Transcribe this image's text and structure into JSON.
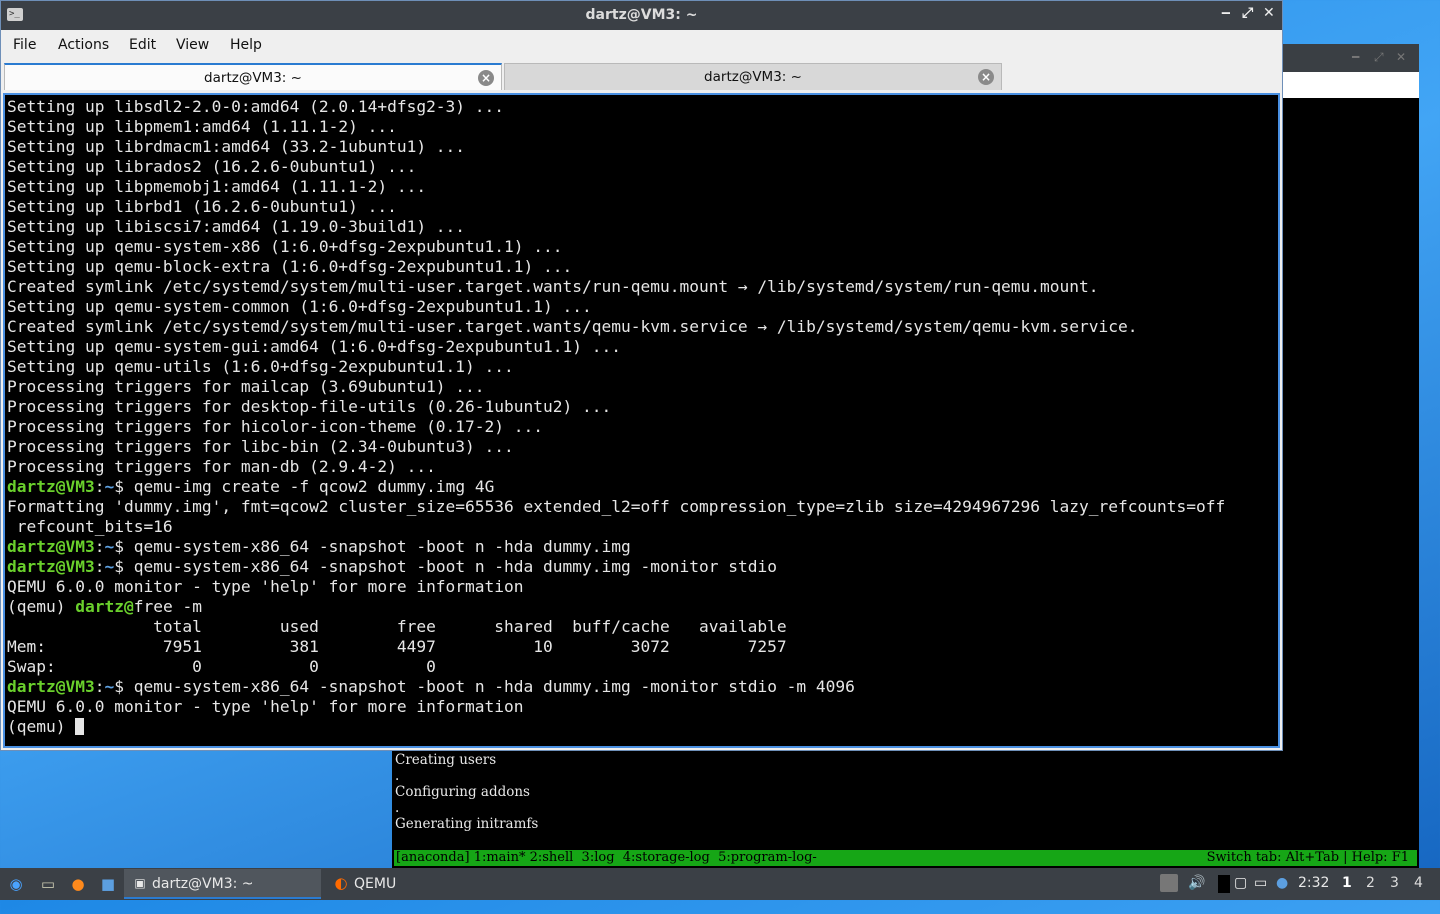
{
  "terminal_window": {
    "title": "dartz@VM3: ~",
    "menu": [
      "File",
      "Actions",
      "Edit",
      "View",
      "Help"
    ],
    "tabs": [
      {
        "label": "dartz@VM3: ~",
        "active": true
      },
      {
        "label": "dartz@VM3: ~",
        "active": false
      }
    ],
    "output_lines": [
      "Setting up libsdl2-2.0-0:amd64 (2.0.14+dfsg2-3) ...",
      "Setting up libpmem1:amd64 (1.11.1-2) ...",
      "Setting up librdmacm1:amd64 (33.2-1ubuntu1) ...",
      "Setting up librados2 (16.2.6-0ubuntu1) ...",
      "Setting up libpmemobj1:amd64 (1.11.1-2) ...",
      "Setting up librbd1 (16.2.6-0ubuntu1) ...",
      "Setting up libiscsi7:amd64 (1.19.0-3build1) ...",
      "Setting up qemu-system-x86 (1:6.0+dfsg-2expubuntu1.1) ...",
      "Setting up qemu-block-extra (1:6.0+dfsg-2expubuntu1.1) ...",
      "Created symlink /etc/systemd/system/multi-user.target.wants/run-qemu.mount → /lib/systemd/system/run-qemu.mount.",
      "Setting up qemu-system-common (1:6.0+dfsg-2expubuntu1.1) ...",
      "Created symlink /etc/systemd/system/multi-user.target.wants/qemu-kvm.service → /lib/systemd/system/qemu-kvm.service.",
      "Setting up qemu-system-gui:amd64 (1:6.0+dfsg-2expubuntu1.1) ...",
      "Setting up qemu-utils (1:6.0+dfsg-2expubuntu1.1) ...",
      "Processing triggers for mailcap (3.69ubuntu1) ...",
      "Processing triggers for desktop-file-utils (0.26-1ubuntu2) ...",
      "Processing triggers for hicolor-icon-theme (0.17-2) ...",
      "Processing triggers for libc-bin (2.34-0ubuntu3) ...",
      "Processing triggers for man-db (2.9.4-2) ..."
    ],
    "session": [
      {
        "prompt": "dartz@VM3",
        "dir": "~",
        "cmd": "qemu-img create -f qcow2 dummy.img 4G"
      },
      {
        "text": "Formatting 'dummy.img', fmt=qcow2 cluster_size=65536 extended_l2=off compression_type=zlib size=4294967296 lazy_refcounts=off"
      },
      {
        "text": " refcount_bits=16"
      },
      {
        "prompt": "dartz@VM3",
        "dir": "~",
        "cmd": "qemu-system-x86_64 -snapshot -boot n -hda dummy.img"
      },
      {
        "prompt": "dartz@VM3",
        "dir": "~",
        "cmd": "qemu-system-x86_64 -snapshot -boot n -hda dummy.img -monitor stdio"
      },
      {
        "text": "QEMU 6.0.0 monitor - type 'help' for more information"
      },
      {
        "qemu_prefix": "(qemu) ",
        "green": "dartz@",
        "rest": "free -m"
      },
      {
        "text": "               total        used        free      shared  buff/cache   available"
      },
      {
        "text": "Mem:            7951         381        4497          10        3072        7257"
      },
      {
        "text": "Swap:              0           0           0"
      },
      {
        "prompt": "dartz@VM3",
        "dir": "~",
        "cmd": "qemu-system-x86_64 -snapshot -boot n -hda dummy.img -monitor stdio -m 4096"
      },
      {
        "text": "QEMU 6.0.0 monitor - type 'help' for more information"
      }
    ],
    "current_prompt": "(qemu) "
  },
  "qemu_window": {
    "console_lines": [
      "Creating users",
      ".",
      "Configuring addons",
      ".",
      "Generating initramfs"
    ],
    "status_left": "[anaconda] 1:main* 2:shell  3:log  4:storage-log  5:program-log-",
    "status_right": "Switch tab: Alt+Tab | Help: F1"
  },
  "taskbar": {
    "tasks": [
      {
        "label": "dartz@VM3: ~",
        "icon": "terminal-icon"
      },
      {
        "label": "QEMU",
        "icon": "qemu-icon"
      }
    ],
    "clock": "2:32",
    "workspaces": [
      "1",
      "2",
      "3",
      "4"
    ]
  },
  "colors": {
    "prompt_green": "#6ad02c",
    "prompt_dir_blue": "#5c9fe0",
    "status_bar_green": "#16a616",
    "accent_blue": "#2a7bd1"
  }
}
